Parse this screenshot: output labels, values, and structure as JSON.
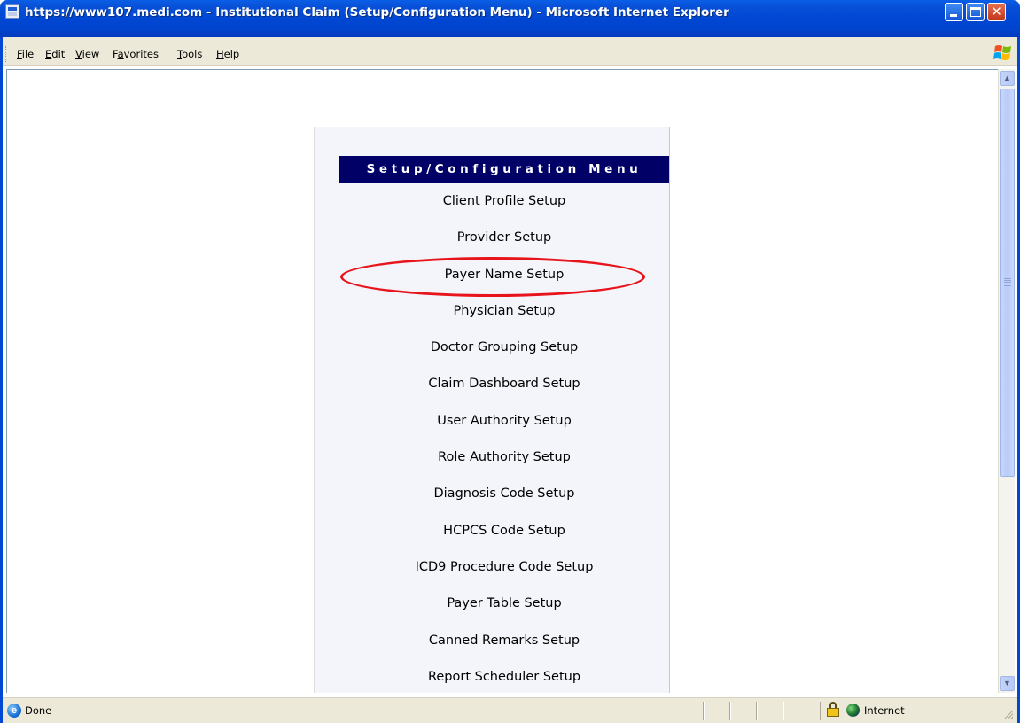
{
  "window": {
    "title": "https://www107.medi.com - Institutional Claim (Setup/Configuration Menu) - Microsoft Internet Explorer",
    "controls": {
      "minimize": "minimize-icon",
      "maximize": "maximize-icon",
      "close": "close-icon"
    }
  },
  "menubar": {
    "items": [
      {
        "label": "File",
        "accel": "F",
        "rest": "ile"
      },
      {
        "label": "Edit",
        "accel": "E",
        "rest": "dit"
      },
      {
        "label": "View",
        "accel": "V",
        "rest": "iew"
      },
      {
        "label": "Favorites",
        "prefix": "F",
        "accel": "a",
        "rest": "vorites"
      },
      {
        "label": "Tools",
        "accel": "T",
        "rest": "ools"
      },
      {
        "label": "Help",
        "accel": "H",
        "rest": "elp"
      }
    ]
  },
  "panel": {
    "header": "Setup/Configuration Menu",
    "items": [
      "Client Profile Setup",
      "Provider Setup",
      "Payer Name Setup",
      "Physician Setup",
      "Doctor Grouping Setup",
      "Claim Dashboard Setup",
      "User Authority Setup",
      "Role Authority Setup",
      "Diagnosis Code Setup",
      "HCPCS Code Setup",
      "ICD9 Procedure Code Setup",
      "Payer Table Setup",
      "Canned Remarks Setup",
      "Report Scheduler Setup"
    ],
    "highlighted_item": "Payer Name Setup",
    "highlight_color": "#e8141b",
    "header_bg": "#000066"
  },
  "statusbar": {
    "status": "Done",
    "zone": "Internet"
  },
  "colors": {
    "titlebar": "#0047d3",
    "chrome": "#ece9d8"
  }
}
